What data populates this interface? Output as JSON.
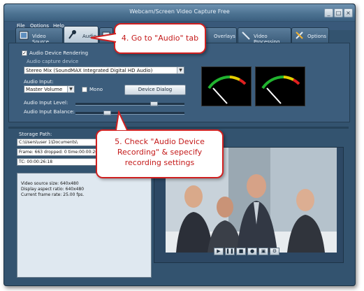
{
  "window": {
    "title": "Webcam/Screen Video Capture Free",
    "controls": [
      "_",
      "□",
      "×"
    ]
  },
  "menu": [
    "File",
    "Options",
    "Help"
  ],
  "tabs": [
    {
      "label": "Video Source",
      "icon": "film-icon"
    },
    {
      "label": "Audio",
      "icon": "microphone-icon",
      "active": true
    },
    {
      "label": "Overlays",
      "icon": "overlay-icon"
    },
    {
      "label": "Video Processing",
      "icon": "wand-icon"
    },
    {
      "label": "Options",
      "icon": "tools-icon"
    }
  ],
  "audio": {
    "enable_label": "Audio Device Rendering",
    "enabled": true,
    "device_label": "Audio capture device",
    "device_value": "Stereo Mix (SoundMAX Integrated Digital HD Audio)",
    "input_label": "Audio Input:",
    "input_value": "Master Volume",
    "mono_label": "Mono",
    "mono_checked": false,
    "device_dialog": "Device Dialog",
    "level_label": "Audio Input Level:",
    "level": 0.72,
    "balance_label": "Audio Input Balance:",
    "balance": 0.5
  },
  "lower": {
    "storage_label": "Storage Path:",
    "storage_value": "C:\\Users\\user 1\\Documents\\",
    "frame_value": "Frame: 663 dropped: 0 time:00:00:26 T",
    "tc_value": "TC: 00:00:26:18",
    "stats": [
      "Video source size: 640x480",
      "Display aspect ratio: 640x480",
      "Current frame rate: 25.00 fps."
    ]
  },
  "callouts": {
    "step4": "4. Go to \"Audio\" tab",
    "step5_line1": "5. Check \"Audio Device",
    "step5_line2": "Recording\" & sepecify",
    "step5_line3": "recording settings"
  },
  "colors": {
    "callout_border": "#d02020",
    "callout_text": "#c41a1a",
    "window": "#33536f"
  }
}
